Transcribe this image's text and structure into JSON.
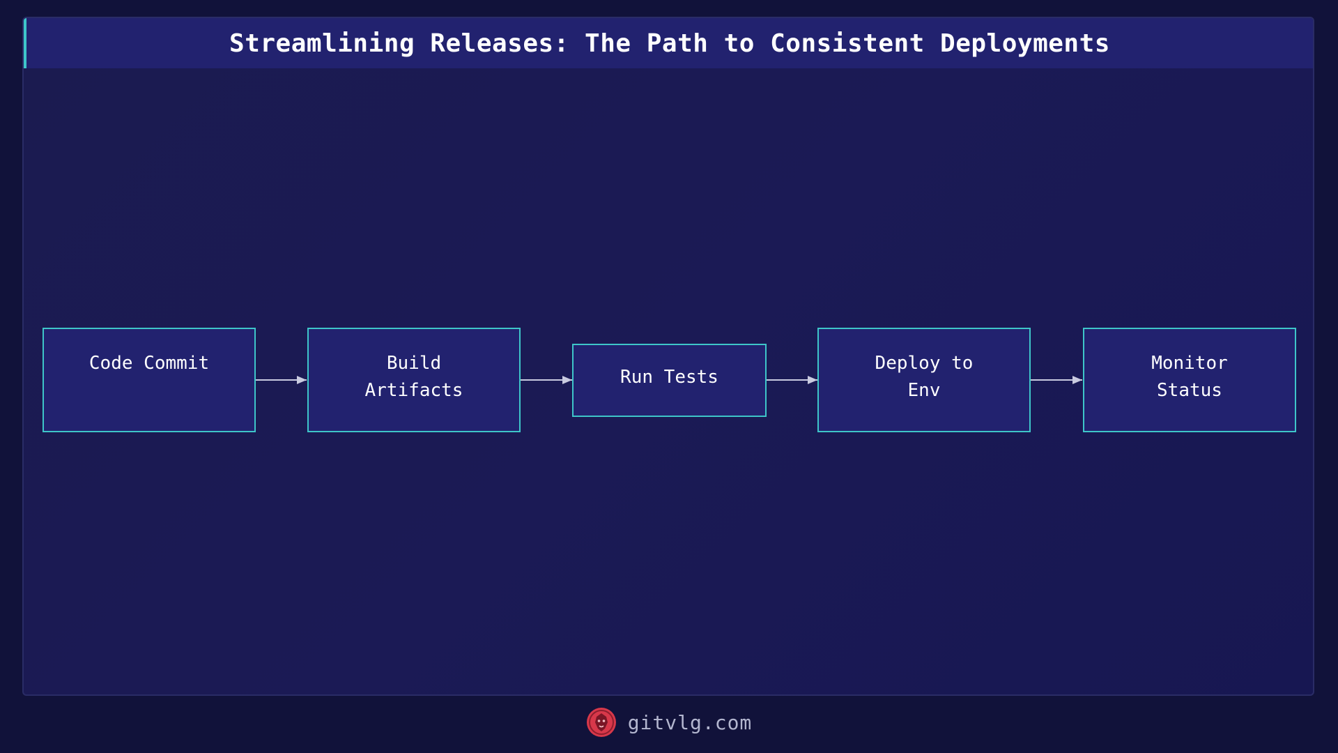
{
  "title": "Streamlining Releases: The Path to Consistent Deployments",
  "flow": {
    "steps": [
      {
        "label": "Code Commit"
      },
      {
        "label": "Build\nArtifacts"
      },
      {
        "label": "Run Tests"
      },
      {
        "label": "Deploy to\nEnv"
      },
      {
        "label": "Monitor\nStatus"
      }
    ]
  },
  "footer": {
    "site": "gitvlg.com",
    "logo_icon": "lion-logo-icon"
  },
  "colors": {
    "background": "#11123a",
    "panel": "#1b1b50",
    "node_fill": "#22226f",
    "node_border": "#3ec6c9",
    "arrow": "#c9cbe0",
    "logo": "#d8384a"
  }
}
